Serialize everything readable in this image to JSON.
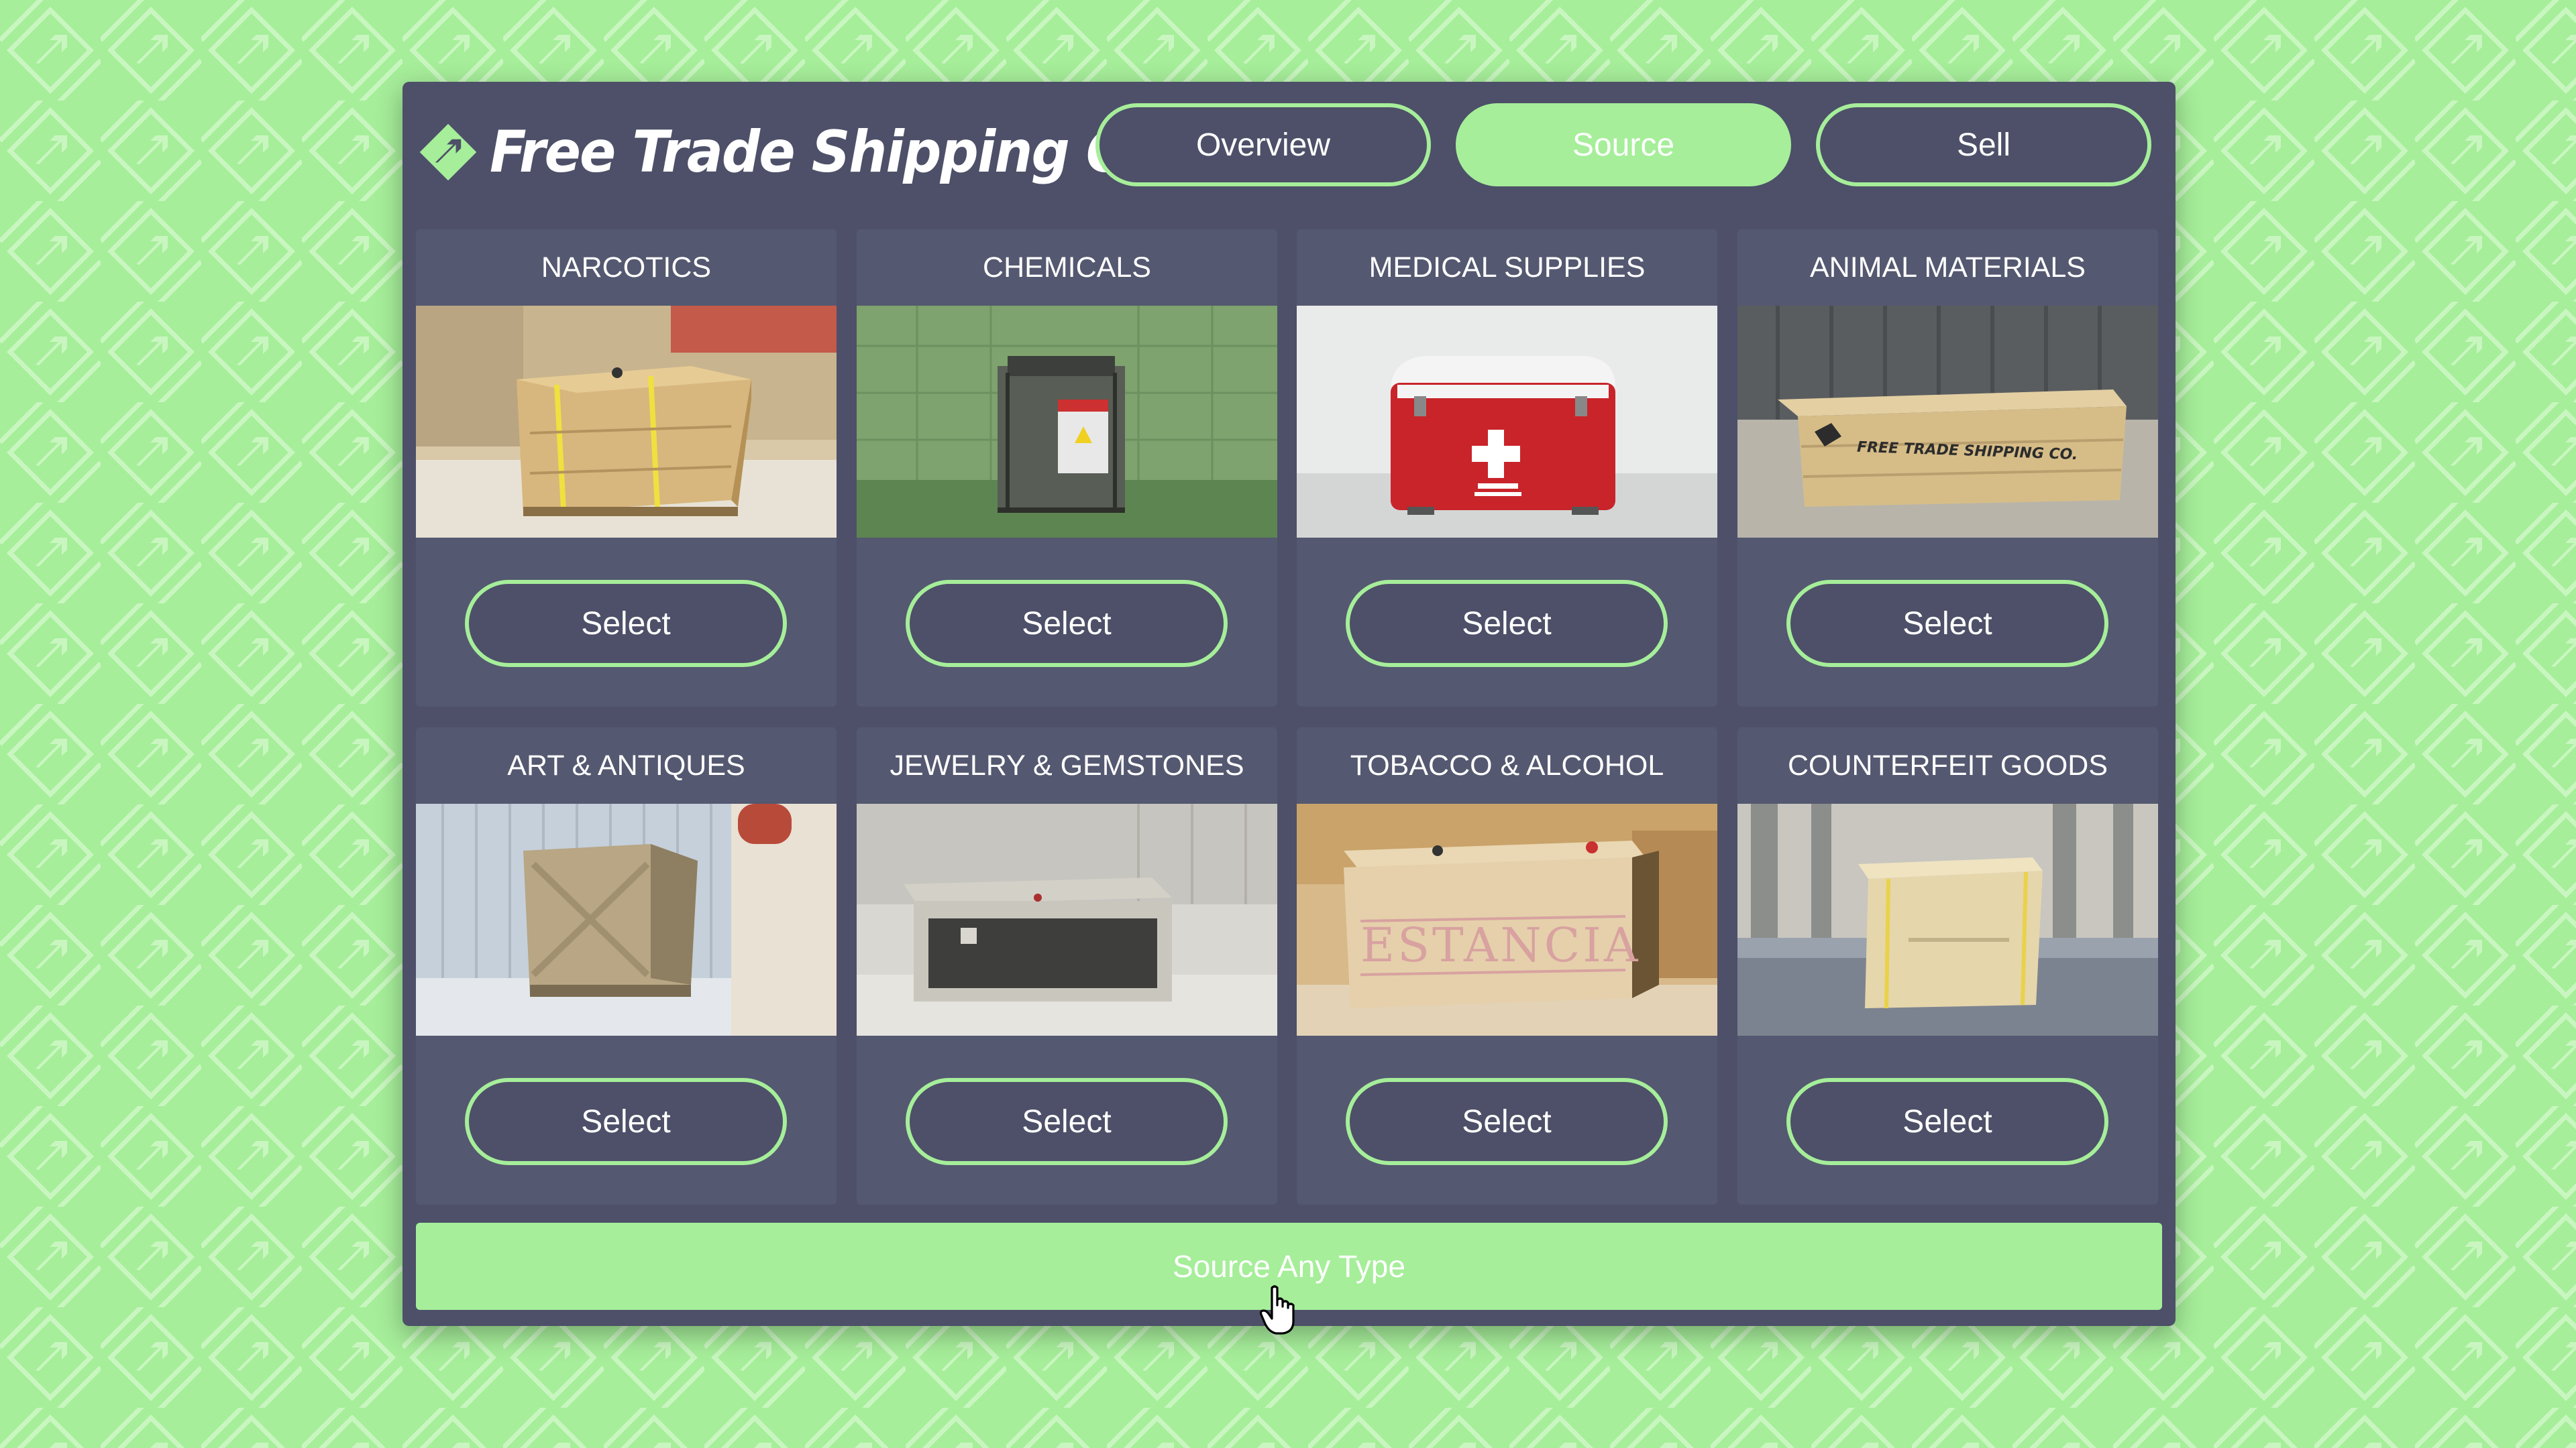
{
  "app": {
    "brand": "Free Trade Shipping Co."
  },
  "tabs": [
    {
      "label": "Overview",
      "active": false
    },
    {
      "label": "Source",
      "active": true
    },
    {
      "label": "Sell",
      "active": false
    }
  ],
  "cargo": [
    {
      "title": "NARCOTICS",
      "button": "Select",
      "icon": "wooden-crate-image"
    },
    {
      "title": "CHEMICALS",
      "button": "Select",
      "icon": "chemical-container-image"
    },
    {
      "title": "MEDICAL SUPPLIES",
      "button": "Select",
      "icon": "medical-cooler-image"
    },
    {
      "title": "ANIMAL MATERIALS",
      "button": "Select",
      "icon": "long-crate-image",
      "stencil": "FREE TRADE SHIPPING CO."
    },
    {
      "title": "ART & ANTIQUES",
      "button": "Select",
      "icon": "slatted-crate-image"
    },
    {
      "title": "JEWELRY & GEMSTONES",
      "button": "Select",
      "icon": "metal-case-image"
    },
    {
      "title": "TOBACCO & ALCOHOL",
      "button": "Select",
      "icon": "estancia-crate-image",
      "stencil": "ESTANCIA"
    },
    {
      "title": "COUNTERFEIT GOODS",
      "button": "Select",
      "icon": "cardboard-box-image"
    }
  ],
  "footer": {
    "source_any_label": "Source Any Type"
  },
  "colors": {
    "accent": "#a6ee9a",
    "panel": "#4d5068",
    "card": "#545870",
    "text": "#ffffff"
  }
}
